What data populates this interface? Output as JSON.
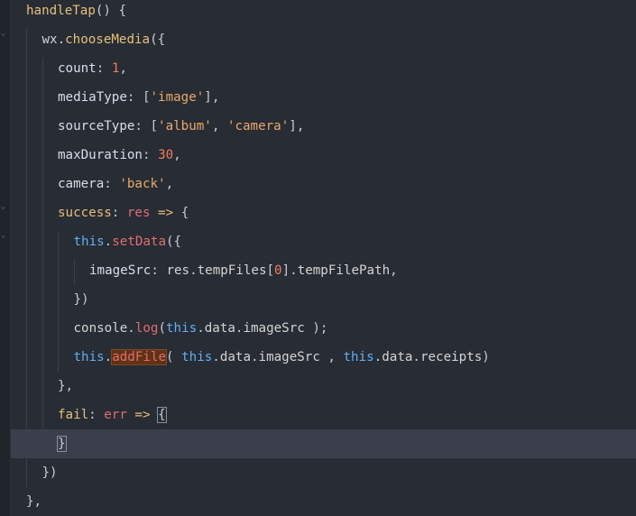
{
  "editor": {
    "lines": [
      {
        "indent": 1,
        "tokens": [
          {
            "t": "handleTap",
            "c": "fn"
          },
          {
            "t": "() {",
            "c": "pun"
          }
        ]
      },
      {
        "indent": 2,
        "tokens": [
          {
            "t": "wx",
            "c": "plain"
          },
          {
            "t": ".",
            "c": "pun"
          },
          {
            "t": "chooseMedia",
            "c": "fn"
          },
          {
            "t": "({",
            "c": "pun"
          }
        ]
      },
      {
        "indent": 3,
        "tokens": [
          {
            "t": "count",
            "c": "key"
          },
          {
            "t": ": ",
            "c": "pun"
          },
          {
            "t": "1",
            "c": "num"
          },
          {
            "t": ",",
            "c": "pun"
          }
        ]
      },
      {
        "indent": 3,
        "tokens": [
          {
            "t": "mediaType",
            "c": "key"
          },
          {
            "t": ": [",
            "c": "pun"
          },
          {
            "t": "'image'",
            "c": "str"
          },
          {
            "t": "],",
            "c": "pun"
          }
        ]
      },
      {
        "indent": 3,
        "tokens": [
          {
            "t": "sourceType",
            "c": "key"
          },
          {
            "t": ": [",
            "c": "pun"
          },
          {
            "t": "'album'",
            "c": "str"
          },
          {
            "t": ", ",
            "c": "pun"
          },
          {
            "t": "'camera'",
            "c": "str"
          },
          {
            "t": "],",
            "c": "pun"
          }
        ]
      },
      {
        "indent": 3,
        "tokens": [
          {
            "t": "maxDuration",
            "c": "key"
          },
          {
            "t": ": ",
            "c": "pun"
          },
          {
            "t": "30",
            "c": "num"
          },
          {
            "t": ",",
            "c": "pun"
          }
        ]
      },
      {
        "indent": 3,
        "tokens": [
          {
            "t": "camera",
            "c": "key"
          },
          {
            "t": ": ",
            "c": "pun"
          },
          {
            "t": "'back'",
            "c": "str"
          },
          {
            "t": ",",
            "c": "pun"
          }
        ]
      },
      {
        "indent": 3,
        "tokens": [
          {
            "t": "success",
            "c": "cb"
          },
          {
            "t": ": ",
            "c": "pun"
          },
          {
            "t": "res",
            "c": "param"
          },
          {
            "t": " => ",
            "c": "arrow"
          },
          {
            "t": "{",
            "c": "pun"
          }
        ]
      },
      {
        "indent": 4,
        "tokens": [
          {
            "t": "this",
            "c": "this"
          },
          {
            "t": ".",
            "c": "pun"
          },
          {
            "t": "setData",
            "c": "meth"
          },
          {
            "t": "({",
            "c": "pun"
          }
        ]
      },
      {
        "indent": 5,
        "tokens": [
          {
            "t": "imageSrc",
            "c": "key"
          },
          {
            "t": ": ",
            "c": "pun"
          },
          {
            "t": "res",
            "c": "plain"
          },
          {
            "t": ".",
            "c": "pun"
          },
          {
            "t": "tempFiles",
            "c": "plain"
          },
          {
            "t": "[",
            "c": "pun"
          },
          {
            "t": "0",
            "c": "num"
          },
          {
            "t": "].",
            "c": "pun"
          },
          {
            "t": "tempFilePath",
            "c": "plain"
          },
          {
            "t": ",",
            "c": "pun"
          }
        ]
      },
      {
        "indent": 4,
        "tokens": [
          {
            "t": "})",
            "c": "pun"
          }
        ]
      },
      {
        "indent": 4,
        "tokens": [
          {
            "t": "console",
            "c": "plain"
          },
          {
            "t": ".",
            "c": "pun"
          },
          {
            "t": "log",
            "c": "meth"
          },
          {
            "t": "(",
            "c": "pun"
          },
          {
            "t": "this",
            "c": "this"
          },
          {
            "t": ".",
            "c": "pun"
          },
          {
            "t": "data",
            "c": "plain"
          },
          {
            "t": ".",
            "c": "pun"
          },
          {
            "t": "imageSrc",
            "c": "plain"
          },
          {
            "t": " );",
            "c": "pun"
          }
        ]
      },
      {
        "indent": 4,
        "tokens": [
          {
            "t": "this",
            "c": "this"
          },
          {
            "t": ".",
            "c": "pun"
          },
          {
            "t": "addFile",
            "c": "meth",
            "hl": true
          },
          {
            "t": "( ",
            "c": "pun"
          },
          {
            "t": "this",
            "c": "this"
          },
          {
            "t": ".",
            "c": "pun"
          },
          {
            "t": "data",
            "c": "plain"
          },
          {
            "t": ".",
            "c": "pun"
          },
          {
            "t": "imageSrc",
            "c": "plain"
          },
          {
            "t": " , ",
            "c": "pun"
          },
          {
            "t": "this",
            "c": "this"
          },
          {
            "t": ".",
            "c": "pun"
          },
          {
            "t": "data",
            "c": "plain"
          },
          {
            "t": ".",
            "c": "pun"
          },
          {
            "t": "receipts",
            "c": "plain"
          },
          {
            "t": ")",
            "c": "pun"
          }
        ]
      },
      {
        "indent": 3,
        "tokens": [
          {
            "t": "},",
            "c": "pun"
          }
        ]
      },
      {
        "indent": 3,
        "tokens": [
          {
            "t": "fail",
            "c": "cb"
          },
          {
            "t": ": ",
            "c": "pun"
          },
          {
            "t": "err",
            "c": "param"
          },
          {
            "t": " => ",
            "c": "arrow"
          },
          {
            "t": "{",
            "c": "pun",
            "match": true
          }
        ]
      },
      {
        "indent": 3,
        "current": true,
        "tokens": [
          {
            "t": "}",
            "c": "pun",
            "match": true
          }
        ]
      },
      {
        "indent": 2,
        "tokens": [
          {
            "t": "})",
            "c": "pun"
          }
        ]
      },
      {
        "indent": 1,
        "tokens": [
          {
            "t": "},",
            "c": "pun"
          }
        ]
      }
    ]
  }
}
